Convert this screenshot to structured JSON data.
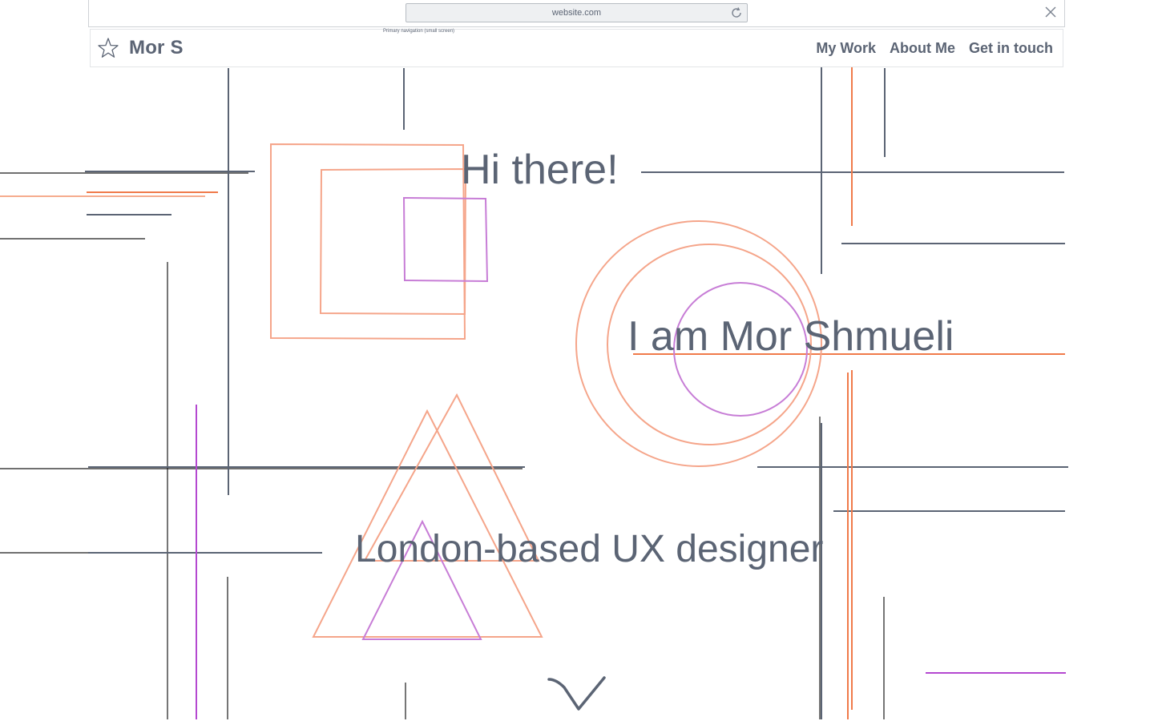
{
  "browser": {
    "url": "website.com",
    "nav_caption": "Primary navigation (small screen)",
    "reload_icon": "reload-icon",
    "close_icon": "close-icon"
  },
  "navbar": {
    "logo_icon": "star-icon",
    "brand": "Mor S",
    "links": [
      {
        "label": "My Work"
      },
      {
        "label": "About Me"
      },
      {
        "label": "Get in touch"
      }
    ]
  },
  "hero": {
    "greeting": "Hi there!",
    "name_line": "I am Mor Shmueli",
    "tagline": "London-based UX designer",
    "scroll_icon": "chevron-down-icon"
  },
  "colors": {
    "text": "#5b6474",
    "line_slate": "#5b6474",
    "line_orange": "#f07a4a",
    "shape_peach": "#f5a58a",
    "shape_purple": "#c77dd6",
    "line_magenta": "#b448d0",
    "line_black": "#1a1a1a"
  }
}
